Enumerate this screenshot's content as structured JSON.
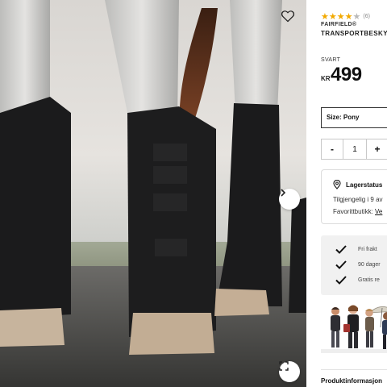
{
  "product": {
    "rating": 4,
    "rating_max": 5,
    "review_count": "(6)",
    "brand": "FAIRFIELD®",
    "title": "TRANSPORTBESKYTTERE"
  },
  "price": {
    "label": "SVART",
    "currency": "KR",
    "amount": "499"
  },
  "size": {
    "label": "Size: Pony"
  },
  "quantity": {
    "minus": "-",
    "value": "1",
    "plus": "+"
  },
  "stock": {
    "title": "Lagerstatus",
    "availability": "Tilgjengelig i 9 av",
    "favorite_label": "Favorittbutikk:",
    "favorite_link": "Ve"
  },
  "usps": [
    {
      "text": "Fri frakt"
    },
    {
      "text": "90 dager"
    },
    {
      "text": "Gratis re"
    }
  ],
  "tabs": {
    "product_info": "Produktinformasjon"
  },
  "colors": {
    "accent_star": "#f2a900",
    "star_empty": "#b9b9b9",
    "boot": "#1b1b1c"
  },
  "icons": {
    "favorite": "heart-icon",
    "next": "chevron-right-icon",
    "expand": "expand-icon",
    "stock": "map-pin-icon",
    "usp": "checkmark-icon"
  }
}
